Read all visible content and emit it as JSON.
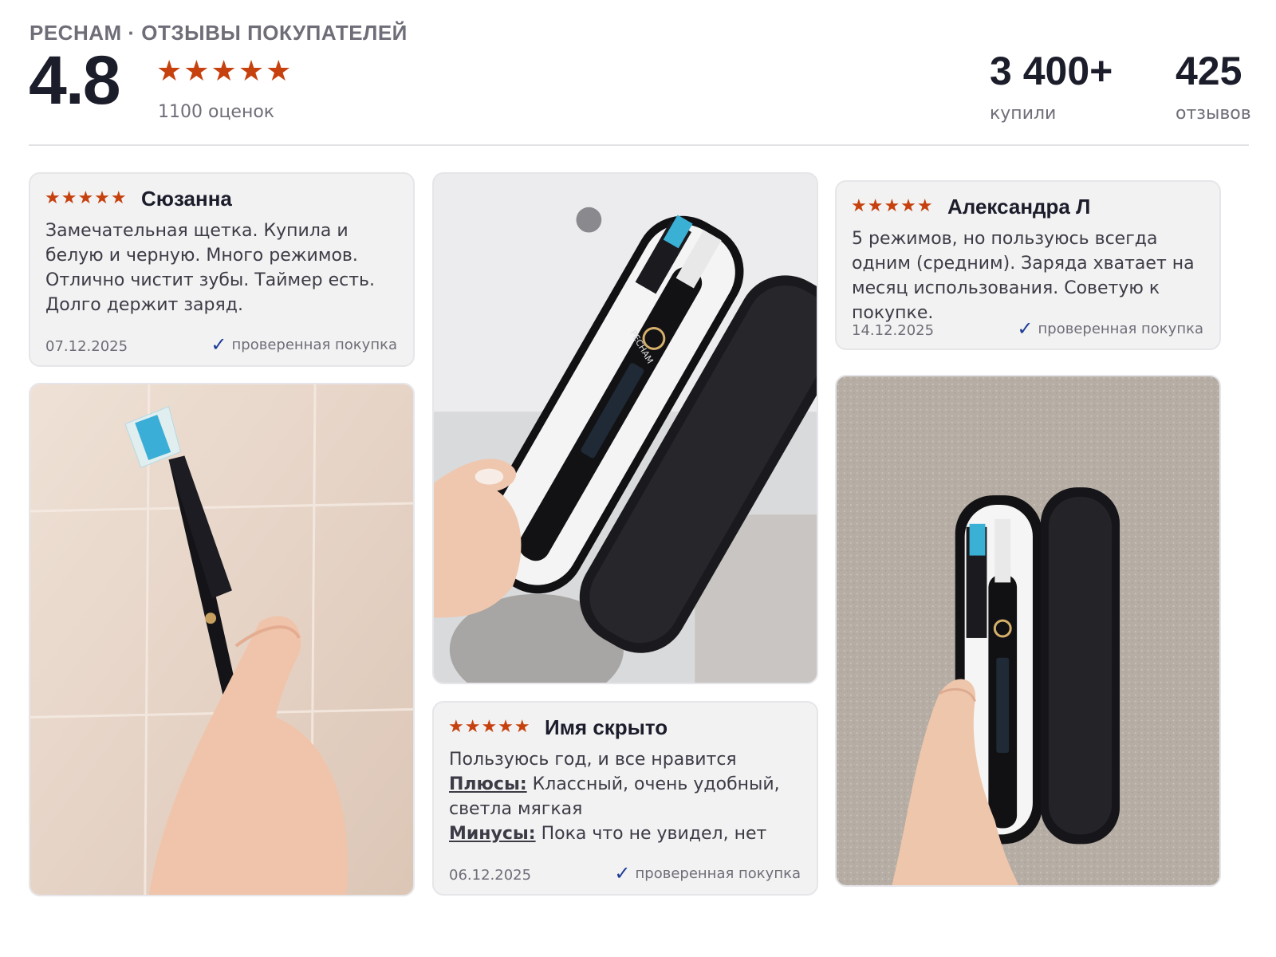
{
  "header": {
    "brand": "PECHAM · ОТЗЫВЫ ПОКУПАТЕЛЕЙ",
    "rating": "4.8",
    "stars": "★★★★★",
    "rating_value": 4.8,
    "ratings_count": "1100 оценок",
    "bought_num": "3 400+",
    "bought_label": "купили",
    "reviews_num": "425",
    "reviews_label": "отзывов"
  },
  "colors": {
    "star": "#c6410e",
    "check": "#1e3c96",
    "title": "#1c1d2b",
    "muted": "#6e6e78"
  },
  "reviews": [
    {
      "stars": "★★★★★",
      "author": "Сюзанна",
      "text": "Замечательная щетка. Купила и белую и черную. Много режимов. Отлично чистит зубы. Таймер есть. Долго держит заряд.",
      "date": "07.12.2025",
      "verified": "проверенная покупка"
    },
    {
      "stars": "★★★★★",
      "author": "Александра Л",
      "text": "5 режимов, но пользуюсь всегда одним (средним). Заряда хватает на месяц использования. Советую к покупке.",
      "date": "14.12.2025",
      "verified": "проверенная покупка"
    },
    {
      "stars": "★★★★★",
      "author": "Имя скрыто",
      "line1": "Пользуюсь год, и все нравится",
      "pros_label": "Плюсы:",
      "pros_text": " Классный, очень удобный,",
      "pros_text2": "светла мягкая",
      "cons_label": "Минусы:",
      "cons_text": " Пока что не увидел, нет",
      "date": "06.12.2025",
      "verified": "проверенная покупка"
    }
  ],
  "photo_texts": {
    "brand_on_brush": "PECHAM"
  },
  "icons": {
    "star": "star-icon",
    "check": "check-icon"
  }
}
